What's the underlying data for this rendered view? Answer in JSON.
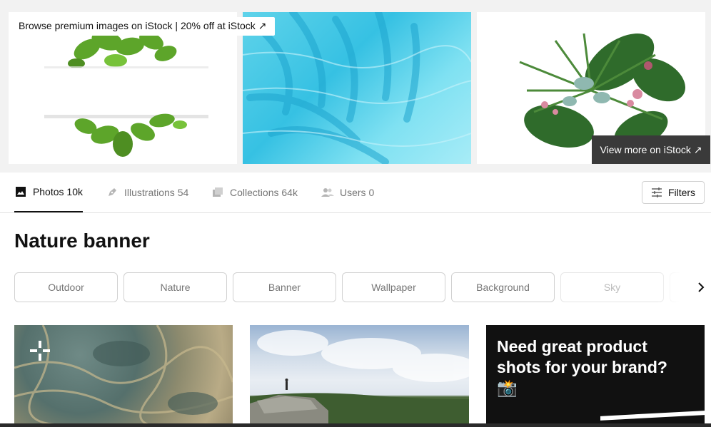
{
  "banner": {
    "browse_text": "Browse premium images on iStock | 20% off at iStock ↗",
    "view_more": "View more on iStock ↗"
  },
  "tabs": [
    {
      "label": "Photos 10k",
      "icon": "photo-icon",
      "active": true
    },
    {
      "label": "Illustrations 54",
      "icon": "pen-nib-icon",
      "active": false
    },
    {
      "label": "Collections 64k",
      "icon": "collections-icon",
      "active": false
    },
    {
      "label": "Users 0",
      "icon": "users-icon",
      "active": false
    }
  ],
  "filters": {
    "label": "Filters",
    "icon": "sliders-icon"
  },
  "page_title": "Nature banner",
  "related": [
    "Outdoor",
    "Nature",
    "Banner",
    "Wallpaper",
    "Background",
    "Sky"
  ],
  "ad": {
    "text": "Need great product shots for your brand? 📸"
  },
  "colors": {
    "accent": "#111111",
    "muted": "#767676",
    "border": "#d1d1d1",
    "banner_bg": "#f2f2f2",
    "view_more_bg": "#3a3a3a"
  }
}
